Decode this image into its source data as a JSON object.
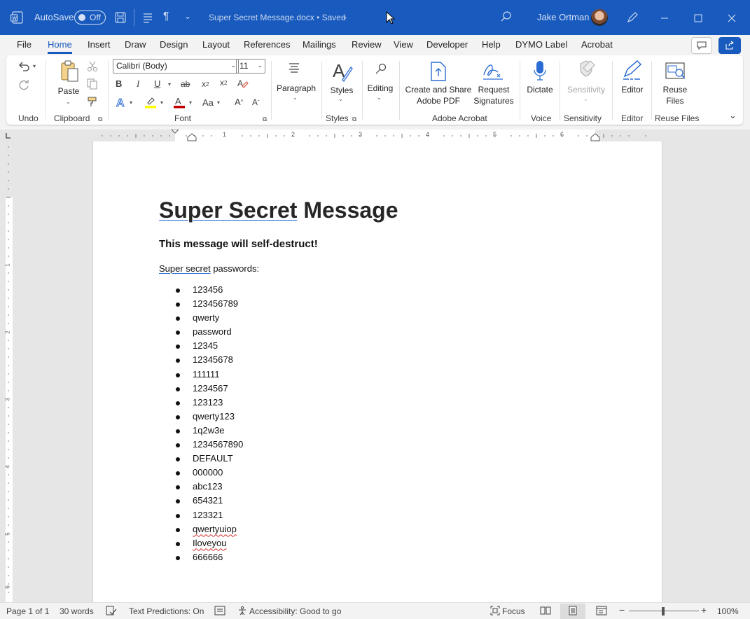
{
  "titlebar": {
    "autosave_label": "AutoSave",
    "autosave_state": "Off",
    "doc_title": "Super Secret Message.docx • Saved",
    "user_name": "Jake Ortman"
  },
  "menu": {
    "tabs": [
      "File",
      "Home",
      "Insert",
      "Draw",
      "Design",
      "Layout",
      "References",
      "Mailings",
      "Review",
      "View",
      "Developer",
      "Help",
      "DYMO Label",
      "Acrobat"
    ],
    "active": "Home"
  },
  "ribbon": {
    "undo_group": "Undo",
    "clipboard_group": "Clipboard",
    "paste_label": "Paste",
    "font_group": "Font",
    "font_name": "Calibri (Body)",
    "font_size": "11",
    "paragraph_label": "Paragraph",
    "styles_label": "Styles",
    "styles_group": "Styles",
    "editing_label": "Editing",
    "create_share_pdf_line1": "Create and Share",
    "create_share_pdf_line2": "Adobe PDF",
    "request_sig_line1": "Request",
    "request_sig_line2": "Signatures",
    "acrobat_group": "Adobe Acrobat",
    "dictate_label": "Dictate",
    "voice_group": "Voice",
    "sensitivity_label": "Sensitivity",
    "sensitivity_group": "Sensitivity",
    "editor_label": "Editor",
    "editor_group": "Editor",
    "reuse_line1": "Reuse",
    "reuse_line2": "Files",
    "reuse_group": "Reuse Files"
  },
  "ruler": {
    "h_numbers": [
      "1",
      "1",
      "2",
      "3",
      "4",
      "5",
      "6"
    ],
    "v_numbers": [
      "1",
      "2",
      "3",
      "4",
      "5",
      "6"
    ]
  },
  "document": {
    "title_part1": "Super Secret",
    "title_part2": " Message",
    "subtitle": "This message will self-destruct!",
    "intro_part1": "Super secret",
    "intro_part2": " passwords:",
    "passwords": [
      "123456",
      "123456789",
      "qwerty",
      "password",
      "12345",
      "12345678",
      "111111",
      "1234567",
      "123123",
      "qwerty123",
      "1q2w3e",
      "1234567890",
      "DEFAULT",
      "000000",
      "abc123",
      "654321",
      "123321",
      "qwertyuiop",
      "Iloveyou",
      "666666"
    ],
    "misspelled": [
      "qwertyuiop",
      "Iloveyou"
    ]
  },
  "statusbar": {
    "page": "Page 1 of 1",
    "words": "30 words",
    "text_predictions": "Text Predictions: On",
    "accessibility": "Accessibility: Good to go",
    "focus": "Focus",
    "zoom": "100%"
  },
  "colors": {
    "title_bar": "#185abd",
    "accent": "#185abd"
  }
}
